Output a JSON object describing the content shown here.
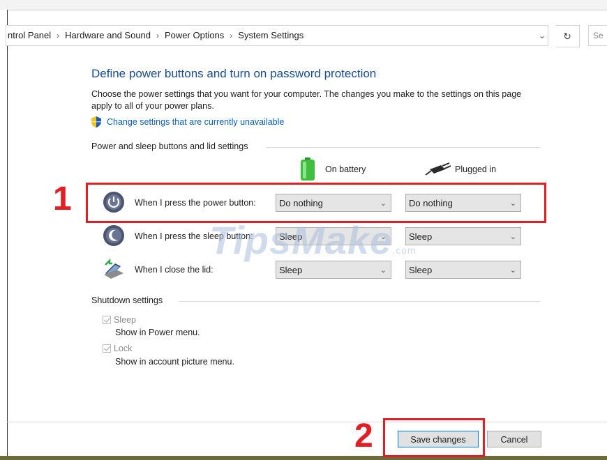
{
  "breadcrumb": {
    "items": [
      "ntrol Panel",
      "Hardware and Sound",
      "Power Options",
      "System Settings"
    ],
    "separator": "›",
    "dropdown_icon": "chevron-down-icon",
    "refresh_icon": "refresh-icon",
    "search_placeholder": "Se"
  },
  "page": {
    "title": "Define power buttons and turn on password protection",
    "description": "Choose the power settings that you want for your computer. The changes you make to the settings on this page apply to all of your power plans.",
    "change_link": "Change settings that are currently unavailable"
  },
  "power_section": {
    "header": "Power and sleep buttons and lid settings",
    "col_battery": "On battery",
    "col_plugged": "Plugged in",
    "rows": [
      {
        "label": "When I press the power button:",
        "battery": "Do nothing",
        "plugged": "Do nothing",
        "icon": "power-icon"
      },
      {
        "label": "When I press the sleep button:",
        "battery": "Sleep",
        "plugged": "Sleep",
        "icon": "sleep-icon"
      },
      {
        "label": "When I close the lid:",
        "battery": "Sleep",
        "plugged": "Sleep",
        "icon": "laptop-lid-icon"
      }
    ]
  },
  "shutdown_section": {
    "header": "Shutdown settings",
    "items": [
      {
        "label": "Sleep",
        "sub": "Show in Power menu.",
        "checked": true
      },
      {
        "label": "Lock",
        "sub": "Show in account picture menu.",
        "checked": true
      }
    ]
  },
  "footer": {
    "save": "Save changes",
    "cancel": "Cancel"
  },
  "annotations": {
    "marker1": "1",
    "marker2": "2",
    "color": "#e21d24"
  },
  "watermark": {
    "text": "TipsMake",
    "suffix": ".com"
  }
}
